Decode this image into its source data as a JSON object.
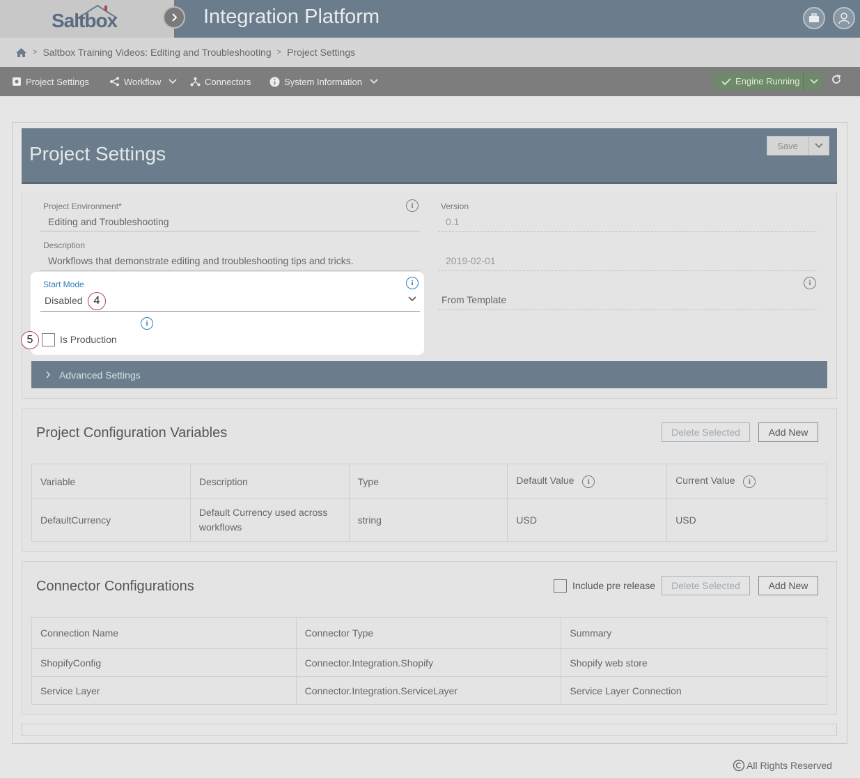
{
  "header": {
    "logo_text": "Saltbox",
    "app_title": "Integration Platform"
  },
  "breadcrumb": {
    "items": [
      "Saltbox Training Videos: Editing and Troubleshooting",
      "Project Settings"
    ]
  },
  "nav": {
    "project_settings": "Project Settings",
    "workflow": "Workflow",
    "connectors": "Connectors",
    "system_information": "System Information",
    "engine_status": "Engine Running"
  },
  "page": {
    "title": "Project Settings",
    "save_label": "Save"
  },
  "form": {
    "env_label": "Project Environment*",
    "env_value": "Editing and Troubleshooting",
    "version_label": "Version",
    "version_value": "0.1",
    "desc_label": "Description",
    "desc_value": "Workflows that demonstrate editing and troubleshooting tips and tricks.",
    "date_value": "2019-02-01",
    "start_mode_label": "Start Mode",
    "start_mode_value": "Disabled",
    "template_value": "From Template",
    "is_production_label": "Is Production",
    "advanced_label": "Advanced Settings"
  },
  "callouts": {
    "start_mode": "4",
    "is_production": "5"
  },
  "config_vars": {
    "title": "Project Configuration Variables",
    "delete_label": "Delete Selected",
    "add_label": "Add New",
    "headers": [
      "Variable",
      "Description",
      "Type",
      "Default Value",
      "Current Value"
    ],
    "rows": [
      [
        "DefaultCurrency",
        "Default Currency used across workflows",
        "string",
        "USD",
        "USD"
      ]
    ]
  },
  "connectors": {
    "title": "Connector Configurations",
    "include_label": "Include pre release",
    "delete_label": "Delete Selected",
    "add_label": "Add New",
    "headers": [
      "Connection Name",
      "Connector Type",
      "Summary"
    ],
    "rows": [
      [
        "ShopifyConfig",
        "Connector.Integration.Shopify",
        "Shopify web store"
      ],
      [
        "Service Layer",
        "Connector.Integration.ServiceLayer",
        "Service Layer Connection"
      ]
    ]
  },
  "footer": {
    "copyright": "All Rights Reserved"
  },
  "colors": {
    "header_bg": "#6b7d8c",
    "nav_bg": "#7d7d7d",
    "engine_green": "#6f8a6a",
    "accent_blue": "#2f7fb5"
  }
}
